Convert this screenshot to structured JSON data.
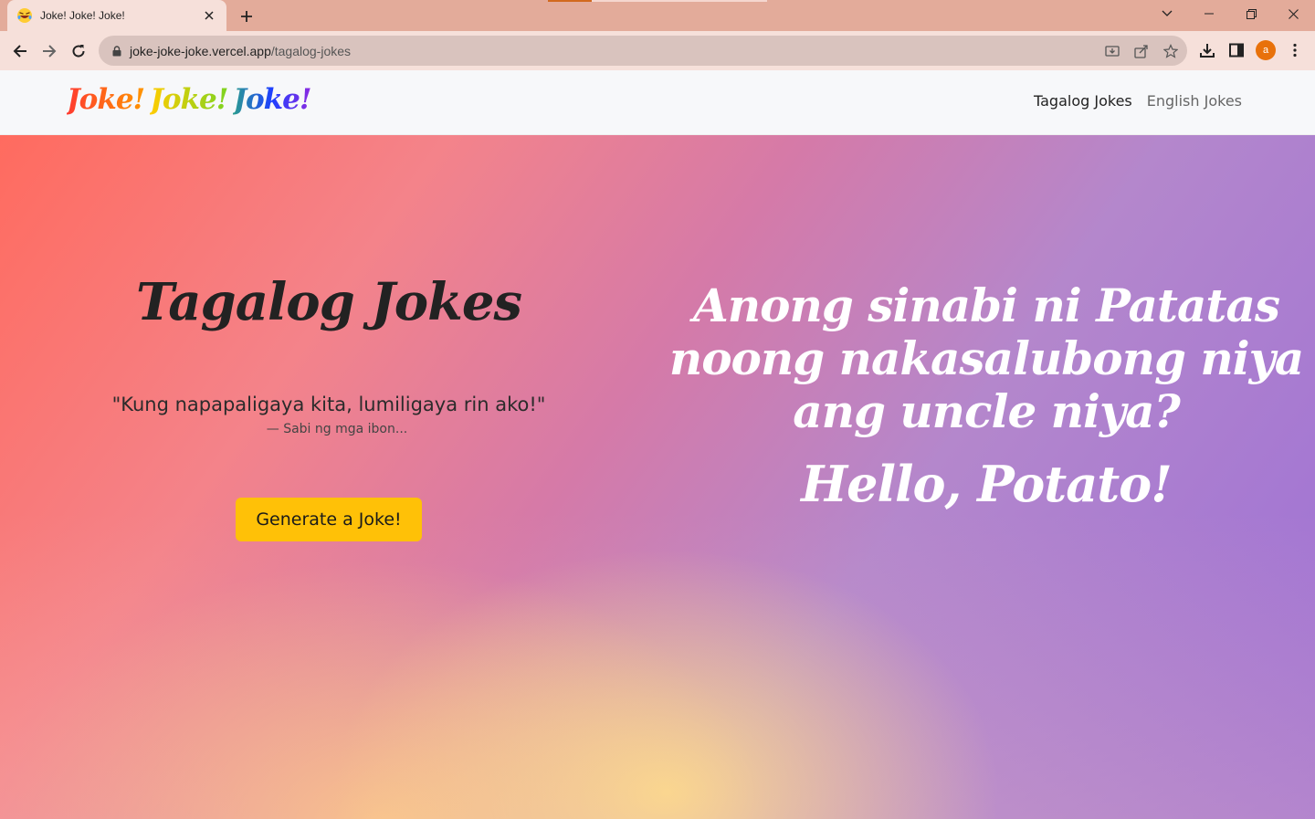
{
  "browser": {
    "tab_title": "Joke! Joke! Joke!",
    "url_host": "joke-joke-joke.vercel.app",
    "url_path": "/tagalog-jokes",
    "profile_initial": "a"
  },
  "site": {
    "brand_parts": [
      "Joke!",
      "Joke!",
      "Joke!"
    ],
    "nav": {
      "tagalog": "Tagalog Jokes",
      "english": "English Jokes"
    }
  },
  "main": {
    "title": "Tagalog Jokes",
    "quote": "\"Kung napapaligaya kita, lumiligaya rin ako!\"",
    "quote_attribution": "— Sabi ng mga ibon...",
    "generate_button": "Generate a Joke!",
    "joke_question": "Anong sinabi ni Patatas noong nakasalubong niya ang uncle niya?",
    "joke_answer": "Hello, Potato!"
  },
  "colors": {
    "button": "#ffc107",
    "gradient_start": "#ff6b5f",
    "gradient_end": "#9c6fd6",
    "chrome_titlebar": "#e3ab9a"
  }
}
